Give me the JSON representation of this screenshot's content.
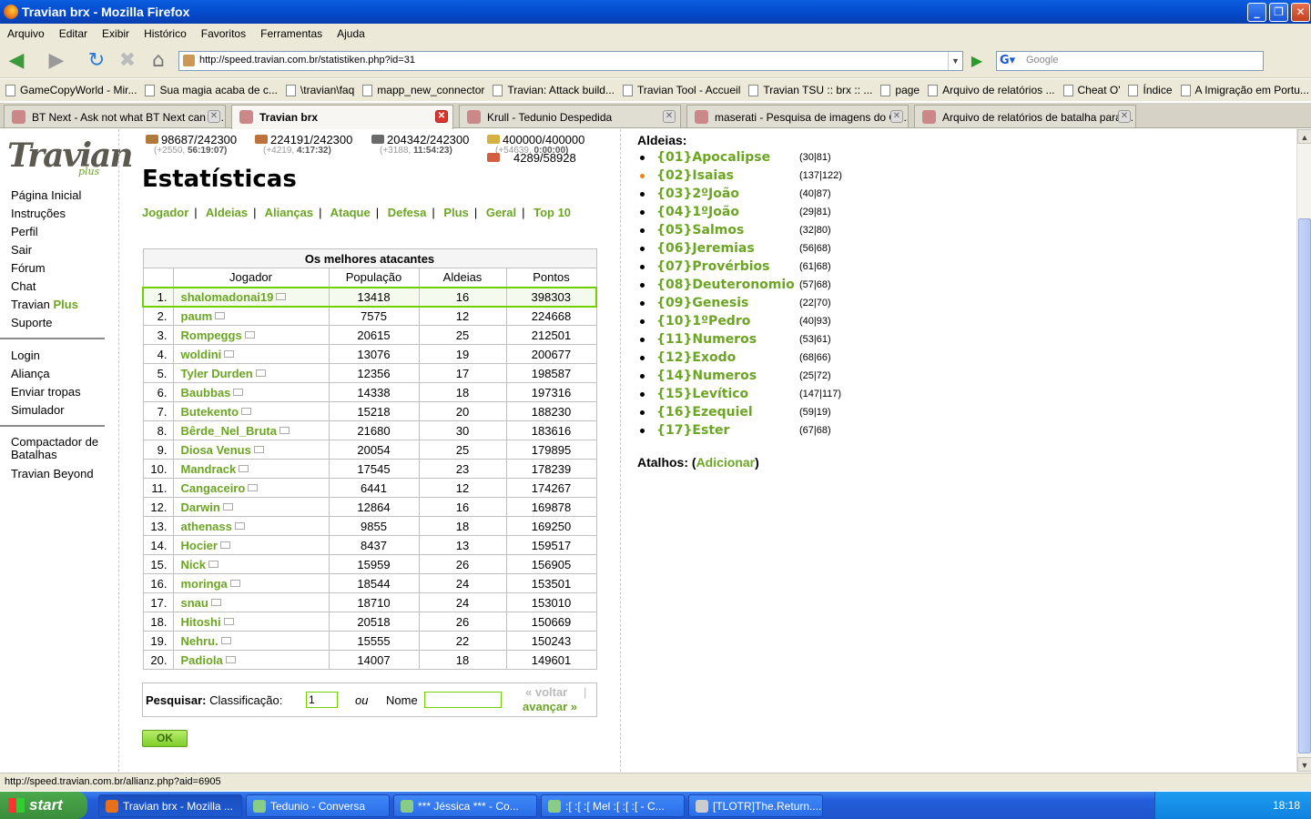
{
  "window": {
    "title": "Travian brx - Mozilla Firefox"
  },
  "menu": [
    "Arquivo",
    "Editar",
    "Exibir",
    "Histórico",
    "Favoritos",
    "Ferramentas",
    "Ajuda"
  ],
  "url": "http://speed.travian.com.br/statistiken.php?id=31",
  "search_placeholder": "Google",
  "bookmarks": [
    "GameCopyWorld - Mir...",
    "Sua magia acaba de c...",
    "\\travian\\faq",
    "mapp_new_connector",
    "Travian: Attack build...",
    "Travian Tool - Accueil",
    "Travian TSU :: brx :: ...",
    "page",
    "Arquivo de relatórios ...",
    "Cheat O'",
    "Índice",
    "A Imigração em Portu..."
  ],
  "tabs": [
    "BT Next - Ask not what BT Next can d...",
    "Travian brx",
    "Krull - Tedunio Despedida",
    "maserati - Pesquisa de imagens do Go...",
    "Arquivo de relatórios de batalha para ..."
  ],
  "logo": {
    "main": "Travian",
    "sub": "plus"
  },
  "sidemenu": {
    "g1": [
      "Página Inicial",
      "Instruções",
      "Perfil",
      "Sair",
      "Fórum",
      "Chat"
    ],
    "travian": "Travian",
    "plus": "Plus",
    "suporte": "Suporte",
    "g2": [
      "Login",
      "Aliança",
      "Enviar tropas",
      "Simulador"
    ],
    "g3": [
      "Compactador de Batalhas",
      "Travian Beyond"
    ]
  },
  "resources": [
    {
      "val": "98687/242300",
      "rate": "(+2550,",
      "time": "56:19:07)",
      "color": "#b07a3a"
    },
    {
      "val": "224191/242300",
      "rate": "(+4219,",
      "time": "4:17:32)",
      "color": "#c0703a"
    },
    {
      "val": "204342/242300",
      "rate": "(+3188,",
      "time": "11:54:23)",
      "color": "#6a6a6a"
    },
    {
      "val": "400000/400000",
      "rate": "(+54639,",
      "time": "0:00:00)",
      "color": "#d4b040"
    }
  ],
  "crop": "4289/58928",
  "page_title": "Estatísticas",
  "statnav": [
    "Jogador",
    "Aldeias",
    "Alianças",
    "Ataque",
    "Defesa",
    "Plus",
    "Geral",
    "Top 10"
  ],
  "table": {
    "caption": "Os melhores atacantes",
    "headers": [
      "Jogador",
      "População",
      "Aldeias",
      "Pontos"
    ],
    "rows": [
      [
        "1.",
        "shalomadonai19",
        "13418",
        "16",
        "398303"
      ],
      [
        "2.",
        "paum",
        "7575",
        "12",
        "224668"
      ],
      [
        "3.",
        "Rompeggs",
        "20615",
        "25",
        "212501"
      ],
      [
        "4.",
        "woldini",
        "13076",
        "19",
        "200677"
      ],
      [
        "5.",
        "Tyler Durden",
        "12356",
        "17",
        "198587"
      ],
      [
        "6.",
        "Baubbas",
        "14338",
        "18",
        "197316"
      ],
      [
        "7.",
        "Butekento",
        "15218",
        "20",
        "188230"
      ],
      [
        "8.",
        "Bêrde_Nel_Bruta",
        "21680",
        "30",
        "183616"
      ],
      [
        "9.",
        "Diosa Venus",
        "20054",
        "25",
        "179895"
      ],
      [
        "10.",
        "Mandrack",
        "17545",
        "23",
        "178239"
      ],
      [
        "11.",
        "Cangaceiro",
        "6441",
        "12",
        "174267"
      ],
      [
        "12.",
        "Darwin",
        "12864",
        "16",
        "169878"
      ],
      [
        "13.",
        "athenass",
        "9855",
        "18",
        "169250"
      ],
      [
        "14.",
        "Hocier",
        "8437",
        "13",
        "159517"
      ],
      [
        "15.",
        "Nick",
        "15959",
        "26",
        "156905"
      ],
      [
        "16.",
        "moringa",
        "18544",
        "24",
        "153501"
      ],
      [
        "17.",
        "snau",
        "18710",
        "24",
        "153010"
      ],
      [
        "18.",
        "Hitoshi",
        "20518",
        "26",
        "150669"
      ],
      [
        "19.",
        "Nehru.",
        "15555",
        "22",
        "150243"
      ],
      [
        "20.",
        "Padiola",
        "14007",
        "18",
        "149601"
      ]
    ]
  },
  "searchform": {
    "label": "Pesquisar:",
    "class_label": "Classificação:",
    "class_value": "1",
    "ou": "ou",
    "nome": "Nome",
    "back": "« voltar",
    "fwd": "avançar »",
    "ok": "OK"
  },
  "villages": {
    "header": "Aldeias:",
    "list": [
      [
        "{01}Apocalipse",
        "(30|81)"
      ],
      [
        "{02}Isaias",
        "(137|122)"
      ],
      [
        "{03}2ºJoão",
        "(40|87)"
      ],
      [
        "{04}1ºJoão",
        "(29|81)"
      ],
      [
        "{05}Salmos",
        "(32|80)"
      ],
      [
        "{06}Jeremias",
        "(56|68)"
      ],
      [
        "{07}Provérbios",
        "(61|68)"
      ],
      [
        "{08}Deuteronomio",
        "(57|68)"
      ],
      [
        "{09}Genesis",
        "(22|70)"
      ],
      [
        "{10}1ºPedro",
        "(40|93)"
      ],
      [
        "{11}Numeros",
        "(53|61)"
      ],
      [
        "{12}Exodo",
        "(68|66)"
      ],
      [
        "{14}Numeros",
        "(25|72)"
      ],
      [
        "{15}Levítico",
        "(147|117)"
      ],
      [
        "{16}Ezequiel",
        "(59|19)"
      ],
      [
        "{17}Ester",
        "(67|68)"
      ]
    ]
  },
  "atalhos": {
    "label": "Atalhos:",
    "link": "Adicionar"
  },
  "status": "http://speed.travian.com.br/allianz.php?aid=6905",
  "taskbar": {
    "start": "start",
    "items": [
      "Travian brx - Mozilla ...",
      "Tedunio - Conversa",
      "*** Jéssica *** - Co...",
      ":[ :[ :[ Mel :[ :[ :[ - C...",
      "[TLOTR]The.Return...."
    ],
    "clock": "18:18"
  }
}
